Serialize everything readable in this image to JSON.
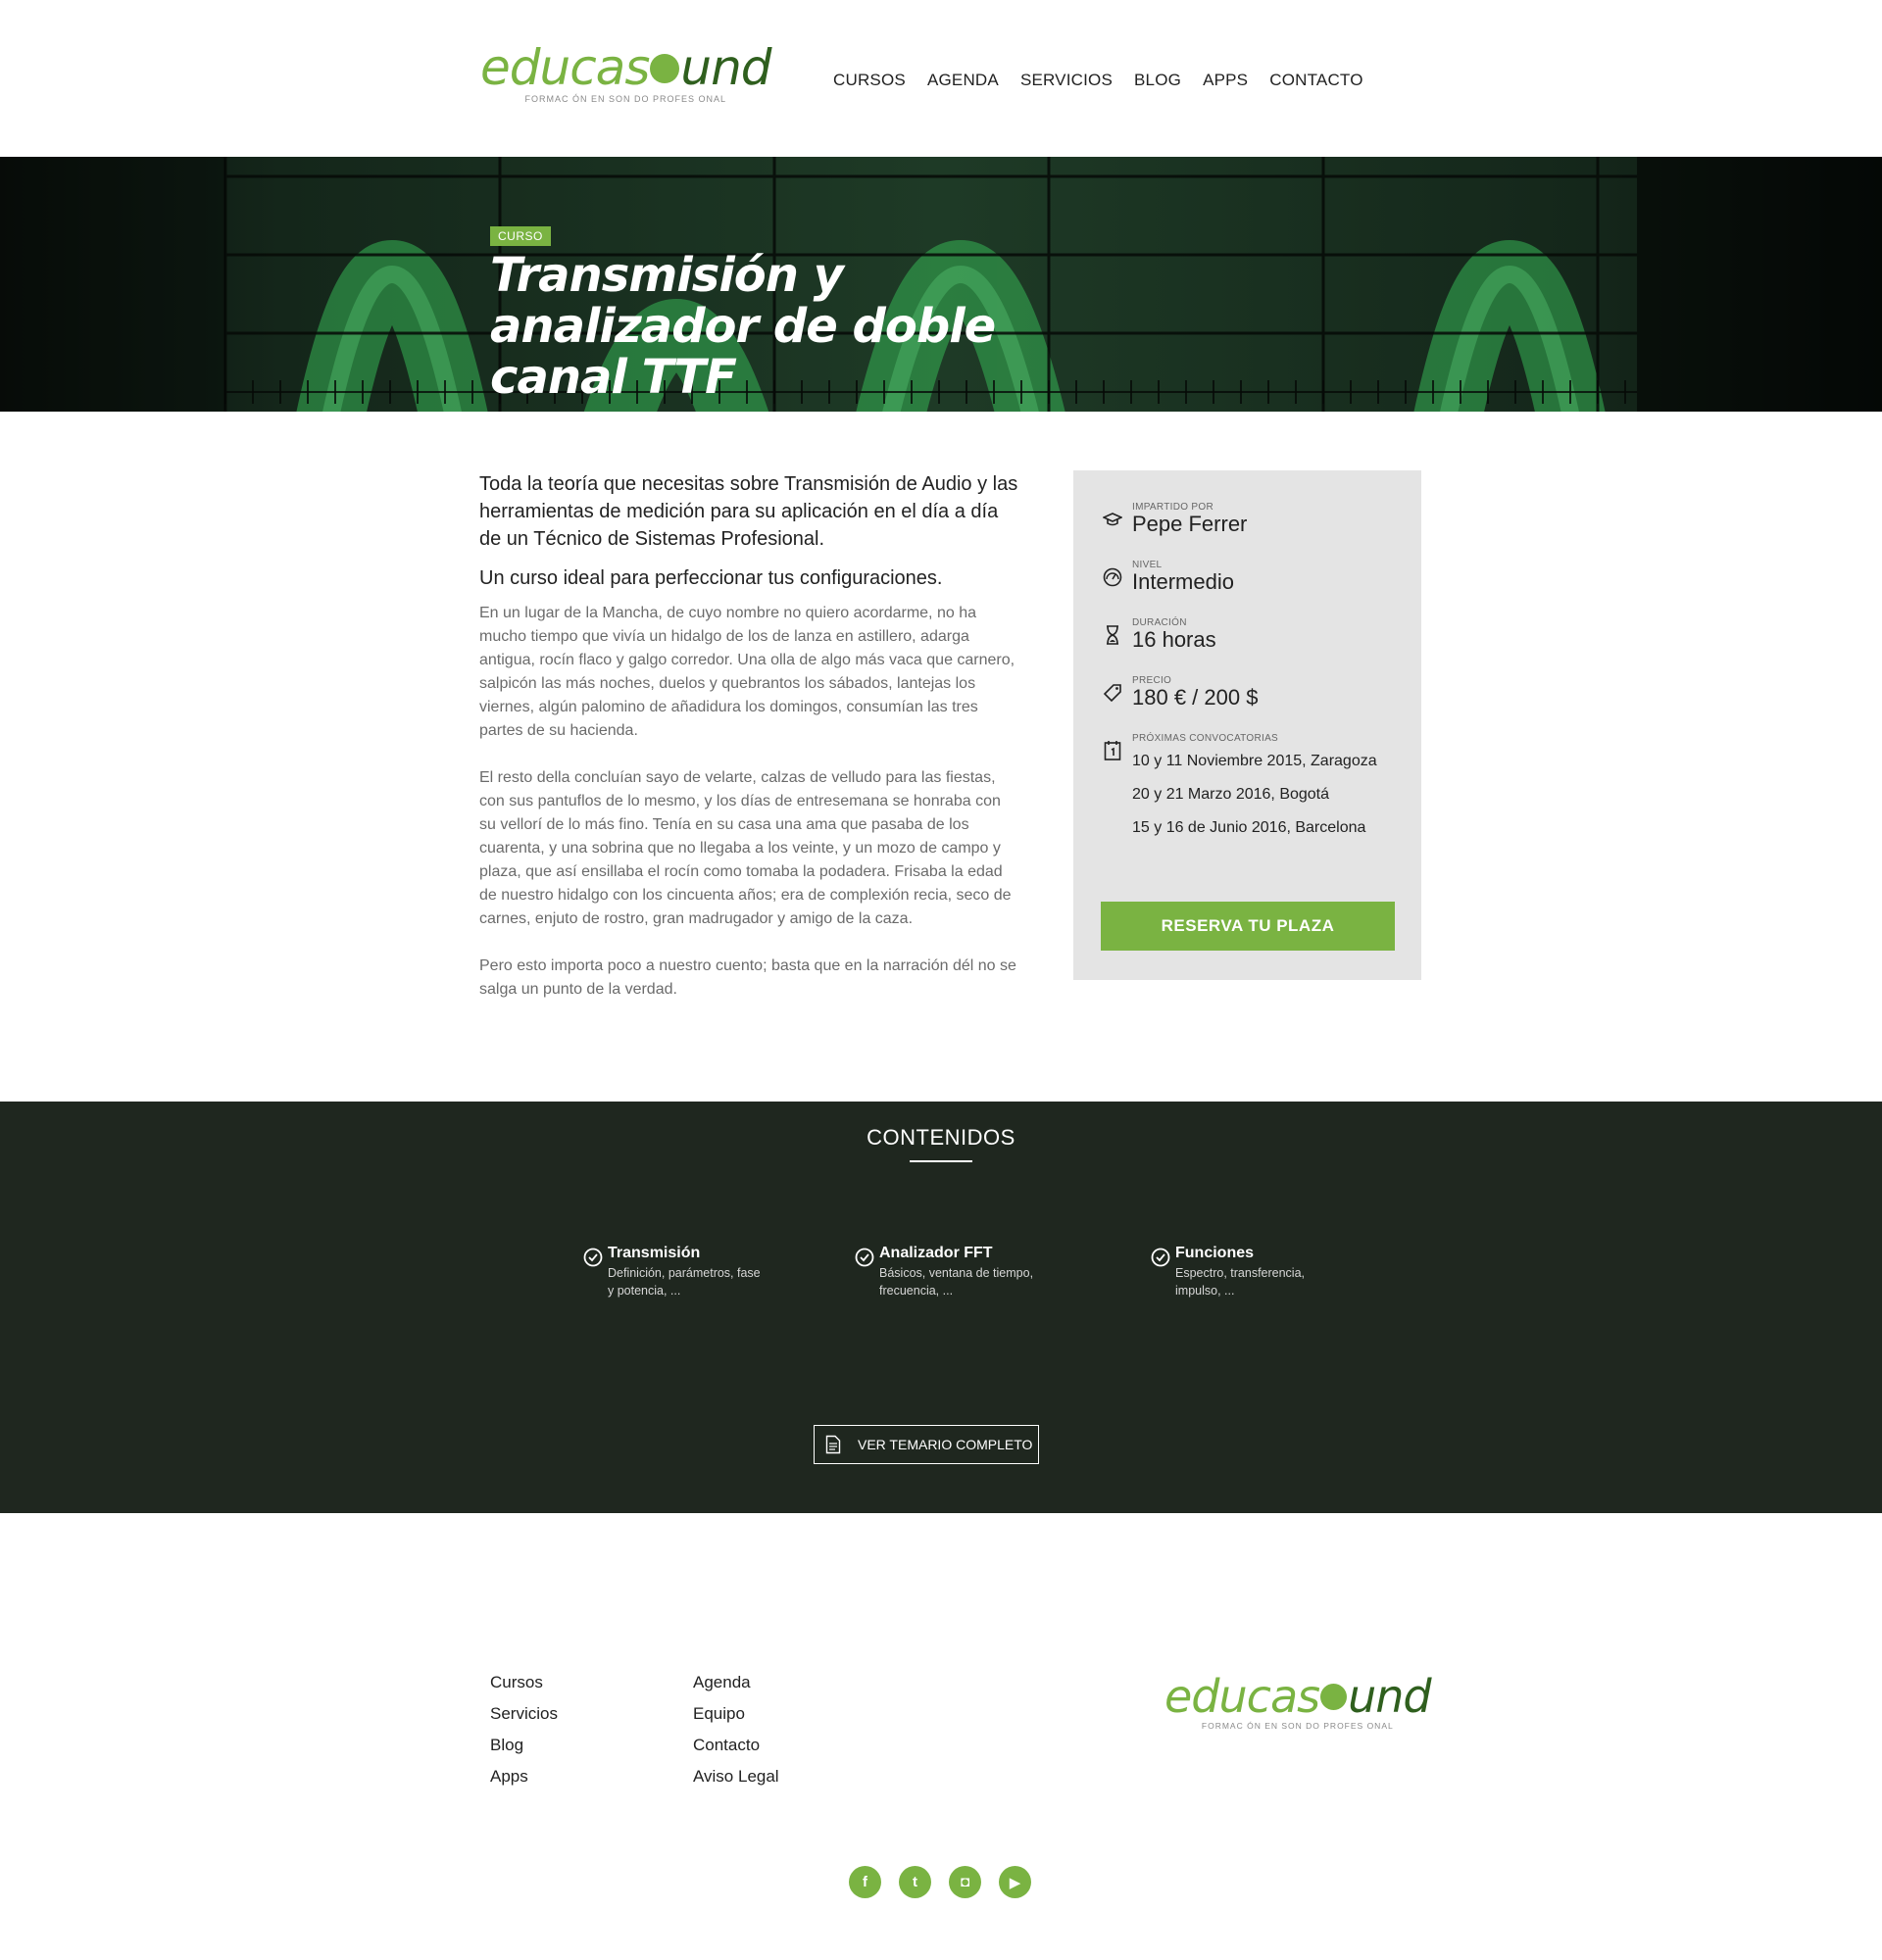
{
  "brand": {
    "logo_part1": "educas",
    "logo_part2": "und",
    "tagline": "FORMAC ÓN EN SON DO PROFES ONAL",
    "accent_color": "#7ab342",
    "dark_green": "#2f5f1e"
  },
  "nav": {
    "items": [
      "CURSOS",
      "AGENDA",
      "SERVICIOS",
      "BLOG",
      "APPS",
      "CONTACTO"
    ]
  },
  "hero": {
    "badge": "CURSO",
    "title": "Transmisión y analizador de doble canal TTF"
  },
  "intro": {
    "lead": "Toda la teoría que necesitas sobre Transmisión de Audio y las herramientas de medición para su aplicación en el día a día de un Técnico de Sistemas Profesional.",
    "lead2": "Un curso ideal para perfeccionar tus configuraciones.",
    "paragraphs": [
      "En un lugar de la Mancha, de cuyo nombre no quiero acordarme, no ha mucho tiempo que vivía un hidalgo de los de lanza en astillero, adarga antigua, rocín flaco y galgo corredor. Una olla de algo más vaca que carnero, salpicón las más noches, duelos y quebrantos los sábados, lantejas los viernes, algún palomino de añadidura los domingos, consumían las tres partes de su hacienda.",
      "El resto della concluían sayo de velarte, calzas de velludo para las fiestas, con sus pantuflos de lo mesmo, y los días de entresemana se honraba con su vellorí de lo más fino. Tenía en su casa una ama que pasaba de los cuarenta, y una sobrina que no llegaba a los veinte, y un mozo de campo y plaza, que así ensillaba el rocín como tomaba la podadera. Frisaba la edad de nuestro hidalgo con los cincuenta años; era de complexión recia, seco de carnes, enjuto de rostro, gran madrugador y amigo de la caza.",
      "Pero esto importa poco a nuestro cuento; basta que en la narración dél no se salga un punto de la verdad."
    ]
  },
  "card": {
    "instructor_label": "IMPARTIDO POR",
    "instructor": "Pepe Ferrer",
    "level_label": "NIVEL",
    "level": "Intermedio",
    "duration_label": "DURACIÓN",
    "duration": "16 horas",
    "price_label": "PRECIO",
    "price": "180 € / 200 $",
    "dates_label": "PRÓXIMAS CONVOCATORIAS",
    "dates": [
      "10 y 11 Noviembre 2015, Zaragoza",
      "20 y 21 Marzo 2016, Bogotá",
      "15 y 16 de Junio 2016, Barcelona"
    ],
    "cta": "RESERVA TU PLAZA"
  },
  "contents": {
    "title": "CONTENIDOS",
    "topics": [
      {
        "title": "Transmisión",
        "desc": "Definición, parámetros, fase y potencia, ..."
      },
      {
        "title": "Analizador FFT",
        "desc": "Básicos, ventana de tiempo, frecuencia, ..."
      },
      {
        "title": "Funciones",
        "desc": "Espectro, transferencia, impulso, ..."
      }
    ],
    "button": "VER TEMARIO COMPLETO"
  },
  "footer": {
    "col1": [
      "Cursos",
      "Servicios",
      "Blog",
      "Apps"
    ],
    "col2": [
      "Agenda",
      "Equipo",
      "Contacto",
      "Aviso Legal"
    ],
    "social": [
      {
        "icon": "facebook-icon",
        "glyph": "f"
      },
      {
        "icon": "twitter-icon",
        "glyph": "t"
      },
      {
        "icon": "instagram-icon",
        "glyph": "◘"
      },
      {
        "icon": "youtube-icon",
        "glyph": "▶"
      }
    ]
  }
}
